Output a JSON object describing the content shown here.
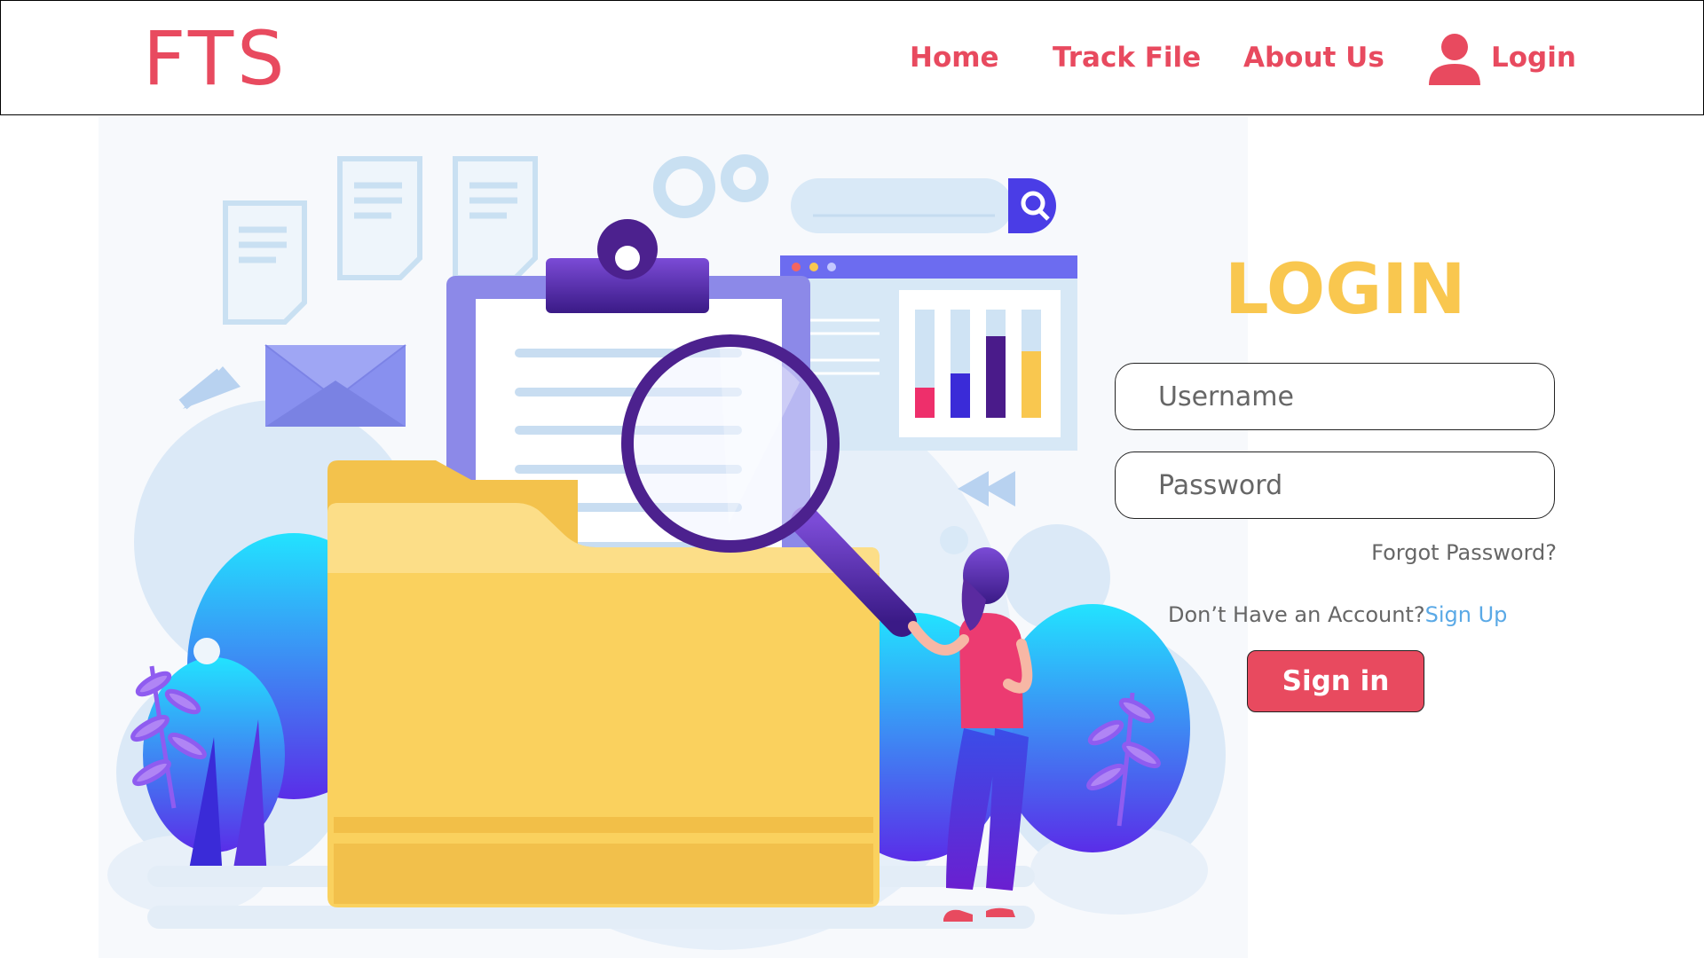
{
  "header": {
    "logo": "FTS",
    "nav": {
      "home": "Home",
      "track_file": "Track File",
      "about_us": "About Us",
      "login": "Login"
    },
    "user_icon": "user-icon"
  },
  "login": {
    "title": "LOGIN",
    "username_placeholder": "Username",
    "password_placeholder": "Password",
    "forgot_password": "Forgot Password?",
    "no_account_text": "Don’t Have an Account?",
    "signup_link": "Sign Up",
    "signin_button": "Sign in"
  },
  "colors": {
    "brand_red": "#e84a5f",
    "title_yellow": "#f9c74f",
    "link_blue": "#5aa9e6"
  }
}
